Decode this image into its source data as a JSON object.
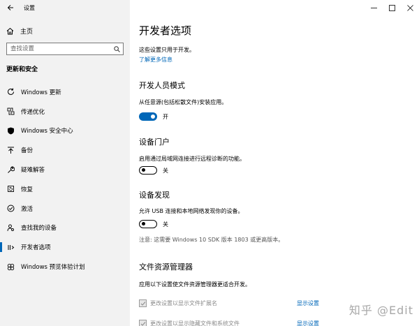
{
  "window": {
    "title": "设置"
  },
  "sidebar": {
    "home_label": "主页",
    "search_placeholder": "查找设置",
    "section_title": "更新和安全",
    "items": [
      {
        "label": "Windows 更新",
        "icon": "refresh-icon"
      },
      {
        "label": "传递优化",
        "icon": "delivery-optimization-icon"
      },
      {
        "label": "Windows 安全中心",
        "icon": "shield-icon"
      },
      {
        "label": "备份",
        "icon": "backup-arrow-icon"
      },
      {
        "label": "疑难解答",
        "icon": "wrench-icon"
      },
      {
        "label": "恢复",
        "icon": "recovery-icon"
      },
      {
        "label": "激活",
        "icon": "check-circle-icon"
      },
      {
        "label": "查找我的设备",
        "icon": "person-locate-icon"
      },
      {
        "label": "开发者选项",
        "icon": "developer-icon",
        "active": true
      },
      {
        "label": "Windows 预览体验计划",
        "icon": "insider-icon"
      }
    ]
  },
  "main": {
    "title": "开发者选项",
    "intro": "这些设置只用于开发。",
    "learn_more": "了解更多信息",
    "dev_mode": {
      "heading": "开发人员模式",
      "desc": "从任意源(包括松散文件)安装应用。",
      "toggle_state": "on",
      "toggle_label": "开"
    },
    "device_portal": {
      "heading": "设备门户",
      "desc": "启用通过局域网连接进行远程诊断的功能。",
      "toggle_state": "off",
      "toggle_label": "关"
    },
    "device_discovery": {
      "heading": "设备发现",
      "desc": "允许 USB 连接和本地网络发现你的设备。",
      "toggle_state": "off",
      "toggle_label": "关",
      "note": "注意: 这需要 Windows 10 SDK 版本 1803 或更高版本。"
    },
    "file_explorer": {
      "heading": "文件资源管理器",
      "desc": "应用以下设置使文件资源管理器更适合开发。",
      "options": [
        {
          "label": "更改设置以显示文件扩展名",
          "action": "显示设置"
        },
        {
          "label": "更改设置以显示隐藏文件和系统文件",
          "action": "显示设置"
        }
      ]
    }
  },
  "watermark": "知乎 @Edit",
  "colors": {
    "accent": "#0067b8",
    "sidebar_bg": "#f2f2f2"
  }
}
